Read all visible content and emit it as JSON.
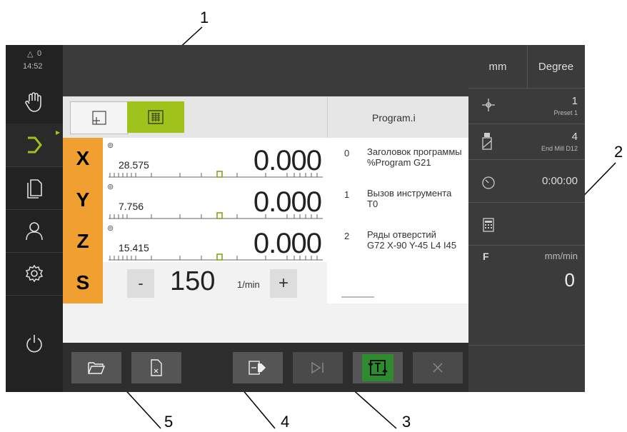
{
  "callouts": [
    "1",
    "2",
    "3",
    "4",
    "5"
  ],
  "status": {
    "warnings": "0",
    "time": "14:52"
  },
  "sidebar": {
    "items": [
      {
        "name": "manual-operation",
        "icon": "hand-icon"
      },
      {
        "name": "mdi-mode",
        "icon": "arrow-enter-icon",
        "active": true
      },
      {
        "name": "file-management",
        "icon": "files-icon"
      },
      {
        "name": "user-login",
        "icon": "user-icon"
      },
      {
        "name": "settings",
        "icon": "gear-icon"
      },
      {
        "name": "switch-off",
        "icon": "power-icon"
      }
    ]
  },
  "units": {
    "linear": "mm",
    "angular": "Degree"
  },
  "view_toggle": {
    "left_icon": "position-view-icon",
    "right_icon": "program-view-icon",
    "active": "right"
  },
  "program": {
    "filename": "Program.i",
    "lines": [
      {
        "num": "0",
        "line1": "Заголовок программы",
        "line2": "%Program G21"
      },
      {
        "num": "1",
        "line1": "Вызов инструмента",
        "line2": "T0"
      },
      {
        "num": "2",
        "line1": "Ряды отверстий",
        "line2": "G72 X-90 Y-45 L4 I45"
      }
    ]
  },
  "axes": [
    {
      "label": "X",
      "small": "28.575",
      "value": "0.000"
    },
    {
      "label": "Y",
      "small": "7.756",
      "value": "0.000"
    },
    {
      "label": "Z",
      "small": "15.415",
      "value": "0.000"
    }
  ],
  "spindle": {
    "label": "S",
    "minus": "-",
    "value": "150",
    "unit": "1/min",
    "plus": "+"
  },
  "right_panel": {
    "preset": {
      "value": "1",
      "label": "Preset 1"
    },
    "tool": {
      "value": "4",
      "label": "End Mill D12"
    },
    "timer": {
      "value": "0:00:00"
    },
    "feed": {
      "label": "F",
      "unit": "mm/min",
      "value": "0"
    }
  },
  "toolbar": {
    "buttons": [
      "open-folder",
      "new-file",
      "run-program",
      "single-block",
      "program-mode",
      "cancel"
    ]
  },
  "colors": {
    "accent": "#f0a030",
    "active_green": "#9ec31b",
    "toggle_green": "#2e8b2e"
  }
}
